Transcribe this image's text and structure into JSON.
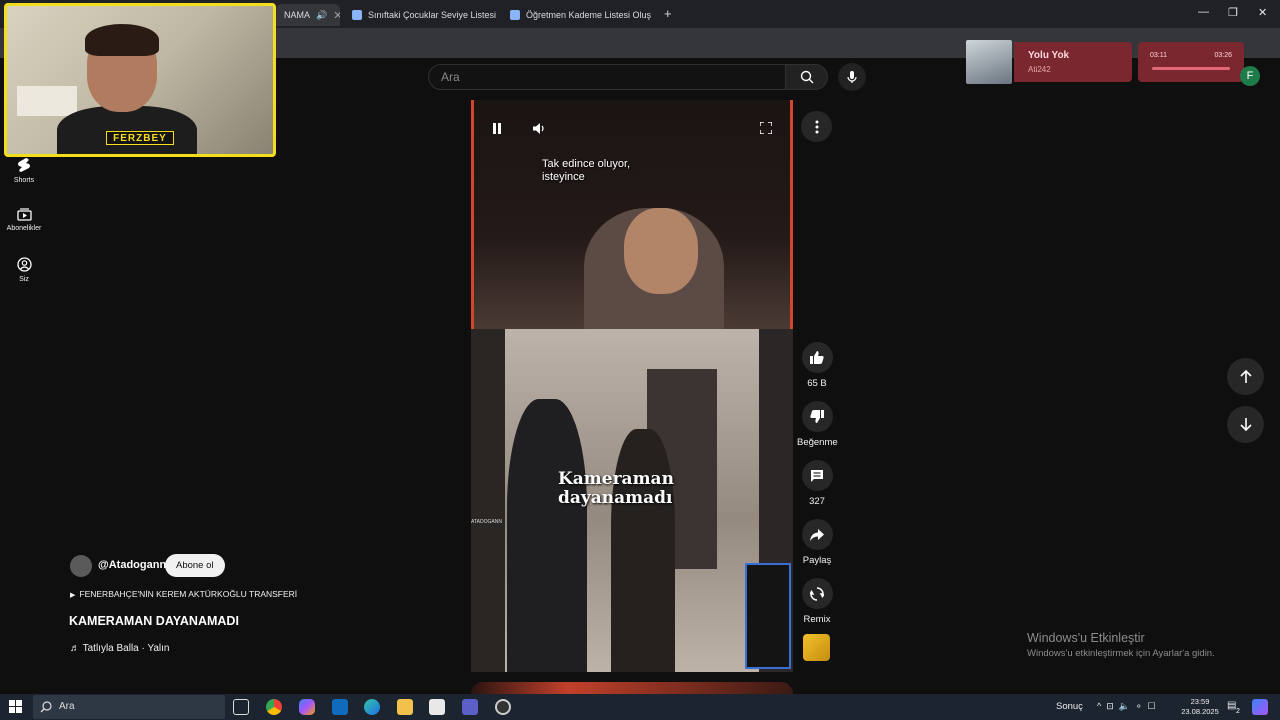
{
  "browser": {
    "tabs": [
      {
        "label": "NAMA"
      },
      {
        "label": "Sınıftaki Çocuklar Seviye Listesi"
      },
      {
        "label": "Öğretmen Kademe Listesi Oluş"
      }
    ],
    "new_tab": "+",
    "window_controls": {
      "minimize": "—",
      "restore": "❐",
      "close": "✕"
    }
  },
  "search": {
    "placeholder": "Ara"
  },
  "account": {
    "initial": "F"
  },
  "sidebar": {
    "items": [
      {
        "label": "Shorts"
      },
      {
        "label": "Abonelikler"
      },
      {
        "label": "Siz"
      }
    ]
  },
  "stream_overlay": {
    "name": "FERZBEY"
  },
  "now_playing": {
    "title": "Yolu Yok",
    "artist": "Ati242",
    "elapsed": "03:11",
    "duration": "03:26",
    "progress": 0.95
  },
  "video": {
    "caption": "Tak edince oluyor,\nisteyince",
    "overlay_text": "Kameraman\ndayanamadı",
    "watermark": "ATADOGANN"
  },
  "actions": {
    "like_count": "65 B",
    "dislike_label": "Beğenme",
    "comment_count": "327",
    "share_label": "Paylaş",
    "remix_label": "Remix"
  },
  "meta": {
    "channel": "@Atadogann",
    "subscribe": "Abone ol",
    "playlist": "FENERBAHÇE'NİN KEREM AKTÜRKOĞLU TRANSFERİ",
    "title": "KAMERAMAN DAYANAMADI",
    "music": "♬ Tatlıyla Balla · Yalın"
  },
  "windows_activation": {
    "title": "Windows'u Etkinleştir",
    "subtitle": "Windows'u etkinleştirmek için Ayarlar'a gidin."
  },
  "taskbar": {
    "search": "Ara",
    "weather": "Sonuç",
    "time": "23:59",
    "date": "23.08.2025",
    "notification_count": "2"
  },
  "colors": {
    "youtube_bg": "#0f0f0f",
    "webcam_frame": "#f5dd1e",
    "now_playing_bg": "#7a2730",
    "video_border": "#d5452a"
  }
}
